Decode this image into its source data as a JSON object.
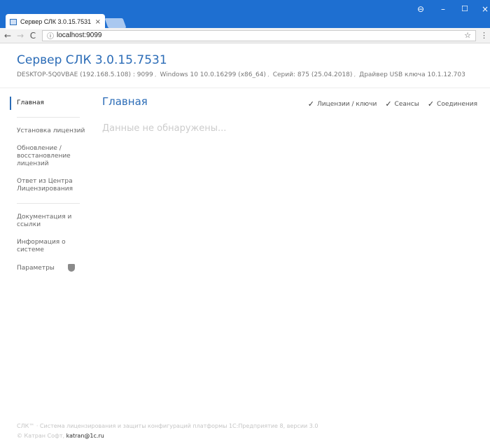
{
  "browser": {
    "tab_title": "Сервер СЛК 3.0.15.7531",
    "tab_close": "×",
    "url": "localhost:9099",
    "win_profile": "⊖",
    "win_min": "–",
    "win_max": "☐",
    "win_close": "×"
  },
  "header": {
    "title": "Сервер СЛК 3.0.15.7531",
    "host": "DESKTOP-5Q0VBAE (192.168.5.108) : 9099",
    "os": "Windows 10 10.0.16299 (x86_64)",
    "series": "Серий: 875 (25.04.2018)",
    "driver": "Драйвер USB ключа 10.1.12.703",
    "sep": ","
  },
  "sidebar": {
    "items": [
      {
        "label": "Главная"
      },
      {
        "label": "Установка лицензий"
      },
      {
        "label": "Обновление / восстановление лицензий"
      },
      {
        "label": "Ответ из Центра Лицензирования"
      },
      {
        "label": "Документация и ссылки"
      },
      {
        "label": "Информация о системе"
      },
      {
        "label": "Параметры"
      }
    ]
  },
  "main": {
    "title": "Главная",
    "empty": "Данные не обнаружены...",
    "filters": [
      {
        "label": "Лицензии / ключи"
      },
      {
        "label": "Сеансы"
      },
      {
        "label": "Соединения"
      }
    ],
    "check": "✓"
  },
  "footer": {
    "line1": "СЛК™ · Система лицензирования и защиты конфигураций платформы 1С:Предприятие 8, версии 3.0",
    "line2_prefix": "© Катран Софт,",
    "email": "katran@1c.ru"
  },
  "colors": {
    "chrome_blue": "#1e6fd1",
    "accent": "#2b6cb7"
  }
}
